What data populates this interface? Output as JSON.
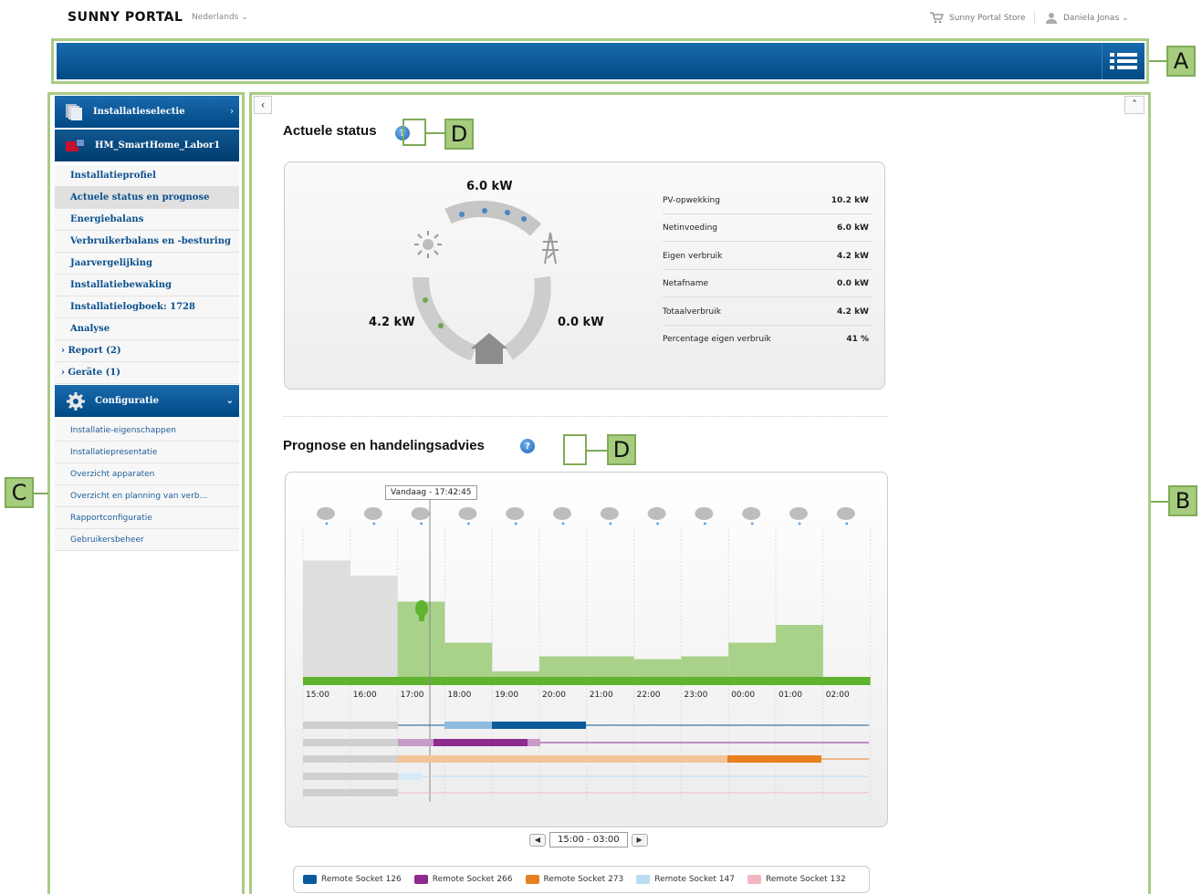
{
  "topbar": {
    "logo": "SUNNY PORTAL",
    "language": "Nederlands ⌄",
    "store": "Sunny Portal Store",
    "user": "Daniela Jonas ⌄"
  },
  "labels": {
    "a": "A",
    "b": "B",
    "c": "C",
    "d1": "D",
    "d2": "D"
  },
  "sidebar": {
    "install_select": "Installatieselectie",
    "plant": "HM_SmartHome_Labor1",
    "items": [
      "Installatieprofiel",
      "Actuele status en prognose",
      "Energiebalans",
      "Verbruikerbalans en -besturing",
      "Jaarvergelijking",
      "Installatiebewaking",
      "Installatielogboek: 1728",
      "Analyse"
    ],
    "sub_items": [
      "› Report (2)",
      "› Geräte (1)"
    ],
    "config_title": "Configuratie",
    "config_items": [
      "Installatie-eigenschappen",
      "Installatiepresentatie",
      "Overzicht apparaten",
      "Overzicht en planning van verb...",
      "Rapportconfiguratie",
      "Gebruikersbeheer"
    ]
  },
  "status": {
    "title": "Actuele status",
    "grid_kw": "6.0 kW",
    "self_kw": "4.2 kW",
    "from_grid_kw": "0.0 kW",
    "rows": [
      {
        "label": "PV-opwekking",
        "value": "10.2 kW"
      },
      {
        "label": "Netinvoeding",
        "value": "6.0 kW"
      },
      {
        "label": "Eigen verbruik",
        "value": "4.2 kW"
      },
      {
        "label": "Netafname",
        "value": "0.0 kW"
      },
      {
        "label": "Totaalverbruik",
        "value": "4.2 kW"
      },
      {
        "label": "Percentage eigen verbruik",
        "value": "41 %"
      }
    ]
  },
  "forecast": {
    "title": "Prognose en handelingsadvies",
    "now_label": "Vandaag - 17:42:45",
    "range": "15:00 - 03:00",
    "legend": [
      {
        "name": "Remote Socket 126",
        "color": "#0a5a9c"
      },
      {
        "name": "Remote Socket 266",
        "color": "#8e2b8e"
      },
      {
        "name": "Remote Socket 273",
        "color": "#e8801f"
      },
      {
        "name": "Remote Socket 147",
        "color": "#b9dcf2"
      },
      {
        "name": "Remote Socket 132",
        "color": "#f2b6c0"
      }
    ]
  },
  "chart_data": {
    "type": "bar",
    "categories": [
      "15:00",
      "16:00",
      "17:00",
      "18:00",
      "19:00",
      "20:00",
      "21:00",
      "22:00",
      "23:00",
      "00:00",
      "01:00",
      "02:00"
    ],
    "values": [
      0.85,
      0.74,
      0.55,
      0.25,
      0.04,
      0.15,
      0.15,
      0.13,
      0.15,
      0.25,
      0.38,
      0
    ],
    "past_count": 2
  }
}
